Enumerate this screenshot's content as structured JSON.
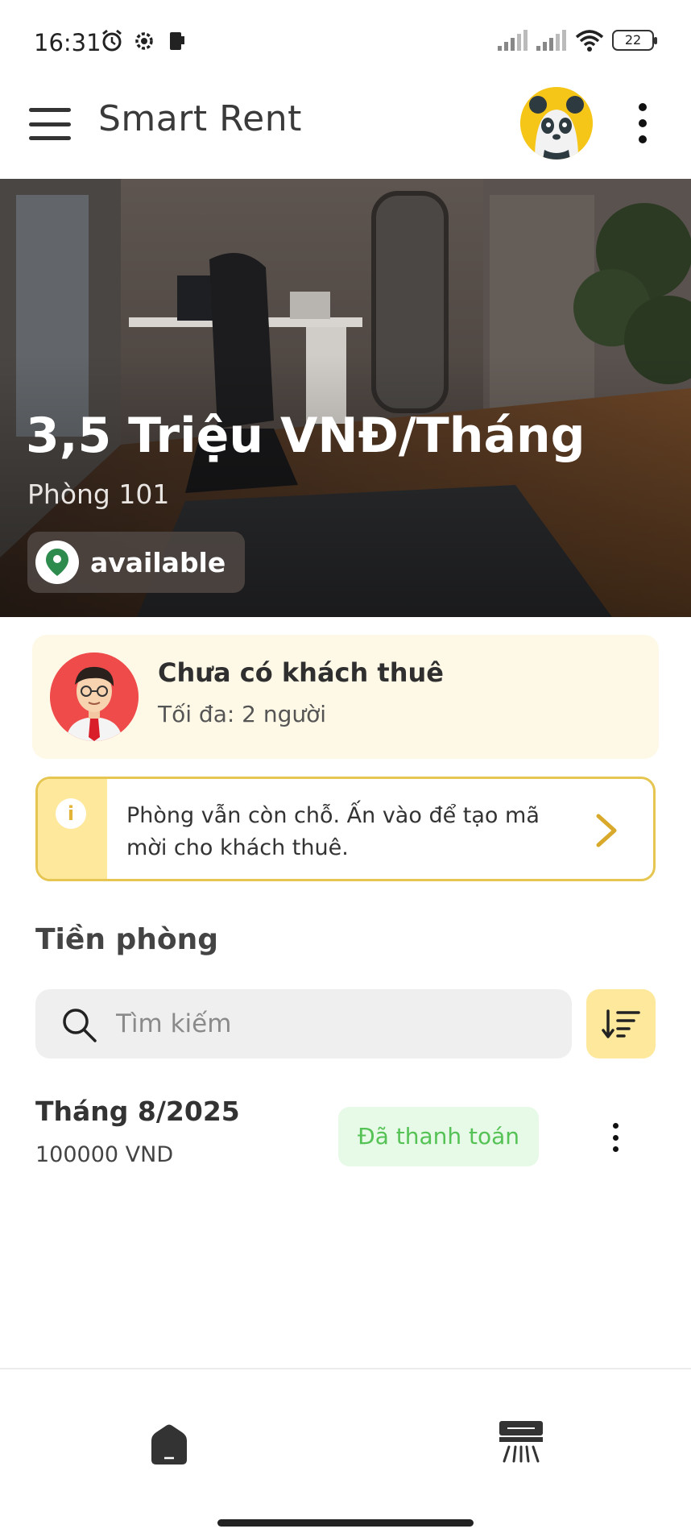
{
  "status_bar": {
    "time": "16:31",
    "battery": "22",
    "left_icons": [
      "alarm-icon",
      "settings-icon",
      "phone-icon"
    ],
    "right_icons": [
      "signal-icon",
      "signal-icon",
      "wifi-icon",
      "battery-icon"
    ]
  },
  "app_bar": {
    "title": "Smart Rent",
    "menu_icon": "hamburger-menu-icon",
    "avatar_icon": "panda-avatar",
    "more_icon": "more-vertical-icon"
  },
  "hero": {
    "price": "3,5 Triệu VNĐ/Tháng",
    "room": "Phòng 101",
    "status": "available",
    "status_icon": "location-pin-icon"
  },
  "tenant_card": {
    "title": "Chưa có khách thuê",
    "subtitle": "Tối đa: 2 người"
  },
  "info_banner": {
    "text": "Phòng vẫn còn chỗ. Ấn vào để tạo mã mời cho khách thuê.",
    "icon": "info-icon",
    "action_icon": "chevron-right-icon"
  },
  "rent_section": {
    "title": "Tiền phòng",
    "search": {
      "placeholder": "Tìm kiếm",
      "value": ""
    },
    "sort_icon": "sort-descending-icon",
    "payments": [
      {
        "month": "Tháng 8/2025",
        "amount": "100000 VND",
        "status": "Đã thanh toán"
      }
    ]
  },
  "bottom_nav": {
    "items": [
      {
        "icon": "home-icon"
      },
      {
        "icon": "air-conditioner-icon"
      }
    ]
  },
  "colors": {
    "accent_yellow": "#fde89c",
    "banner_border": "#e6c550",
    "tenant_card_bg": "#fef8e6",
    "paid_bg": "#e7f9e7",
    "paid_text": "#55c255"
  }
}
